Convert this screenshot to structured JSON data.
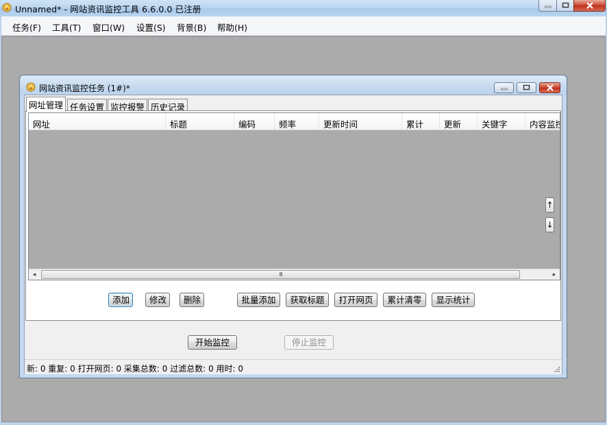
{
  "window": {
    "title": "Unnamed* - 网站资讯监控工具 6.6.0.0  已注册"
  },
  "menu": [
    {
      "label": "任务(F)"
    },
    {
      "label": "工具(T)"
    },
    {
      "label": "窗口(W)"
    },
    {
      "label": "设置(S)"
    },
    {
      "label": "背景(B)"
    },
    {
      "label": "帮助(H)"
    }
  ],
  "child_window": {
    "title": "网站资讯监控任务   (1#)*"
  },
  "tabs": [
    {
      "label": "网址管理",
      "active": true
    },
    {
      "label": "任务设置",
      "active": false
    },
    {
      "label": "监控报警",
      "active": false
    },
    {
      "label": "历史记录",
      "active": false
    }
  ],
  "list_columns": [
    "网址",
    "标题",
    "编码",
    "频率",
    "更新时间",
    "累计",
    "更新",
    "关键字",
    "内容监控"
  ],
  "scroll_glyphs": {
    "left": "◂",
    "right": "▸",
    "thumb": "III",
    "up": "↑",
    "down": "↓"
  },
  "actions": {
    "add": "添加",
    "edit": "修改",
    "delete": "删除",
    "batch_add": "批量添加",
    "fetch_title": "获取标题",
    "open_page": "打开网页",
    "reset_count": "累计清零",
    "show_stats": "显示统计"
  },
  "controls": {
    "start": "开始监控",
    "stop": "停止监控"
  },
  "status_text": "新:  0   重复:  0   打开网页:  0   采集总数:  0   过滤总数:  0   用时:  0"
}
